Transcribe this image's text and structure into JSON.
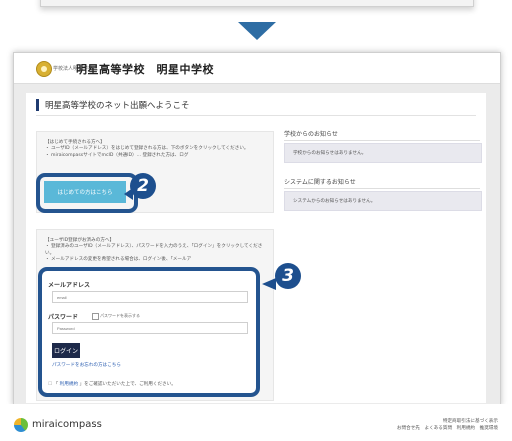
{
  "school": {
    "tag": "学校法人明星学苑",
    "name": "明星高等学校　明星中学校"
  },
  "welcome_title": "明星高等学校のネット出願へようこそ",
  "first_time": {
    "heading": "【はじめて手続される方へ】",
    "bullet1": "・ ユーザID（メールアドレス）をはじめて登録される方は、下のボタンをクリックしてください。",
    "bullet2": "・ miraicompassサイトでmcID（共通ID）... 登録された方は、ログ",
    "button_label": "はじめての方はこちら"
  },
  "registered": {
    "heading": "【ユーザID登録がお済みの方へ】",
    "bullet1": "・ 登録済みのユーザID（メールアドレス）、パスワードを入力のうえ、「ログイン」をクリックしてください。",
    "bullet2": "・ メールアドレスの変更を希望される場合は、ログイン後、「メールア"
  },
  "login": {
    "email_label": "メールアドレス",
    "email_placeholder": "email",
    "password_label": "パスワード",
    "show_password_label": "パスワードを表示する",
    "password_placeholder": "Password",
    "login_button": "ログイン",
    "forgot_link": "パスワードをお忘れの方はこちら",
    "agree_prefix": "「",
    "agree_link": "利用規約",
    "agree_suffix": "」をご確認いただいた上で、ご利用ください。"
  },
  "notices": {
    "school_heading": "学校からのお知らせ",
    "school_text": "学校からのお知らせはありません。",
    "system_heading": "システムに関するお知らせ",
    "system_text": "システムからのお知らせはありません。"
  },
  "badges": {
    "two": "2",
    "three": "3"
  },
  "footer": {
    "logo_text": "miraicompass",
    "line1": "特定商取引法に基づく表示",
    "line2": "お問合せ先　よくある質問　利用規約　推奨環境"
  },
  "colors": {
    "highlight": "#24548f",
    "badge": "#1d4f8e",
    "first_button": "#5ab8d8",
    "login_button": "#1e2a4a"
  }
}
